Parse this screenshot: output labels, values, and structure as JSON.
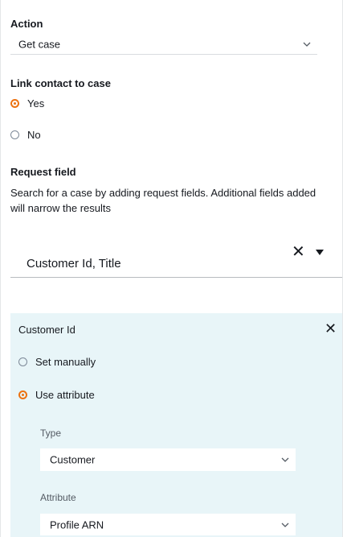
{
  "action": {
    "label": "Action",
    "selected": "Get case",
    "chevron_icon": "chevron-down-icon"
  },
  "link_contact": {
    "label": "Link contact to case",
    "options": [
      {
        "label": "Yes",
        "checked": true
      },
      {
        "label": "No",
        "checked": false
      }
    ]
  },
  "request_field": {
    "label": "Request field",
    "description": "Search for a case by adding request fields. Additional fields added will narrow the results",
    "multiselect_value": "Customer Id, Title",
    "clear_icon": "close-icon",
    "caret_icon": "caret-down-icon"
  },
  "panel": {
    "title": "Customer Id",
    "close_icon": "close-icon",
    "options": [
      {
        "label": "Set manually",
        "checked": false
      },
      {
        "label": "Use attribute",
        "checked": true
      }
    ],
    "type_label": "Type",
    "type_value": "Customer",
    "attribute_label": "Attribute",
    "attribute_value": "Profile ARN"
  },
  "colors": {
    "accent": "#ec7211",
    "panel_bg": "#e8f5f8",
    "text": "#16191f",
    "secondary_text": "#545b64"
  }
}
